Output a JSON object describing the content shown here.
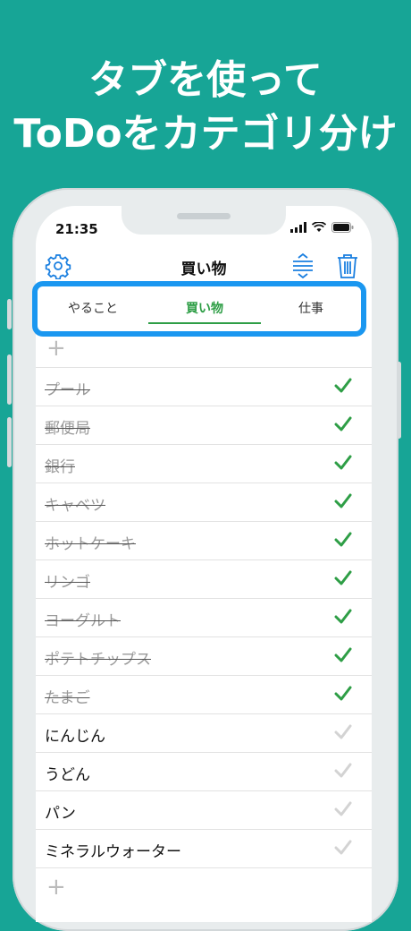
{
  "headline": {
    "line1": "タブを使って",
    "line2": "ToDoをカテゴリ分け"
  },
  "status": {
    "time": "21:35"
  },
  "nav": {
    "title": "買い物"
  },
  "tabs": [
    {
      "label": "やること",
      "active": false
    },
    {
      "label": "買い物",
      "active": true
    },
    {
      "label": "仕事",
      "active": false
    }
  ],
  "items": [
    {
      "label": "プール",
      "done": true
    },
    {
      "label": "郵便局",
      "done": true
    },
    {
      "label": "銀行",
      "done": true
    },
    {
      "label": "キャベツ",
      "done": true
    },
    {
      "label": "ホットケーキ",
      "done": true
    },
    {
      "label": "リンゴ",
      "done": true
    },
    {
      "label": "ヨーグルト",
      "done": true
    },
    {
      "label": "ポテトチップス",
      "done": true
    },
    {
      "label": "たまご",
      "done": true
    },
    {
      "label": "にんじん",
      "done": false
    },
    {
      "label": "うどん",
      "done": false
    },
    {
      "label": "パン",
      "done": false
    },
    {
      "label": "ミネラルウォーター",
      "done": false
    }
  ],
  "colors": {
    "background": "#17a596",
    "accent_blue": "#1a97f0",
    "check_green": "#2e9e46",
    "check_gray": "#d3d3d3"
  }
}
